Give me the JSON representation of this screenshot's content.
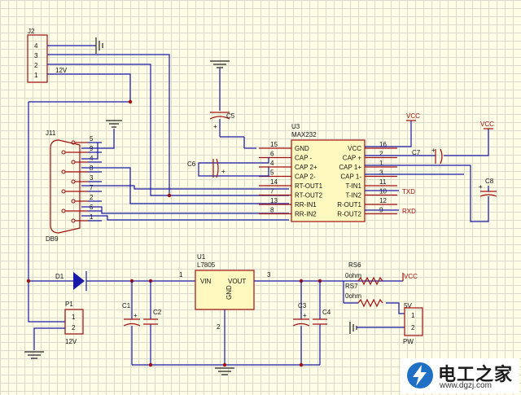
{
  "connector_j2": {
    "ref": "J2",
    "pins": [
      "4",
      "3",
      "2",
      "1"
    ],
    "net": "12V"
  },
  "db9": {
    "ref": "J11",
    "name": "DB9",
    "pins": [
      "5",
      "9",
      "4",
      "8",
      "3",
      "7",
      "2",
      "6",
      "1"
    ]
  },
  "max232": {
    "ref": "U3",
    "part": "MAX232",
    "left_pins": [
      {
        "num": "15",
        "name": "GND"
      },
      {
        "num": "6",
        "name": "CAP -"
      },
      {
        "num": "4",
        "name": "CAP 2+"
      },
      {
        "num": "5",
        "name": "CAP 2-"
      },
      {
        "num": "14",
        "name": "RT-OUT1"
      },
      {
        "num": "7",
        "name": "RT-OUT2"
      },
      {
        "num": "13",
        "name": "RR-IN1"
      },
      {
        "num": "8",
        "name": "RR-IN2"
      }
    ],
    "right_pins": [
      {
        "num": "16",
        "name": "VCC"
      },
      {
        "num": "2",
        "name": "CAP +"
      },
      {
        "num": "1",
        "name": "CAP 1+"
      },
      {
        "num": "3",
        "name": "CAP 1-"
      },
      {
        "num": "11",
        "name": "T-IN1"
      },
      {
        "num": "10",
        "name": "T-IN2"
      },
      {
        "num": "12",
        "name": "R-OUT1"
      },
      {
        "num": "9",
        "name": "R-OUT2"
      }
    ]
  },
  "regulator": {
    "ref": "U1",
    "part": "L7805",
    "vin": "VIN",
    "vout": "VOUT",
    "gnd": "GND",
    "pin_in": "1",
    "pin_out": "3",
    "pin_gnd": "2"
  },
  "caps": {
    "c1": "C1",
    "c2": "C2",
    "c3": "C3",
    "c4": "C4",
    "c5": "C5",
    "c6": "C6",
    "c7": "C7",
    "c8": "C8"
  },
  "diode": "D1",
  "p1": {
    "ref": "P1",
    "pins": [
      "1",
      "2"
    ],
    "net": "12V"
  },
  "pw": {
    "ref": "PW",
    "pins": [
      "1",
      "2"
    ]
  },
  "res": {
    "rs6": "RS6",
    "rs6_val": "0ohm",
    "rs7": "RS7",
    "rs7_val": "0ohm"
  },
  "nets": {
    "vcc": "VCC",
    "v5": "5V",
    "txd": "TXD",
    "rxd": "RXD"
  },
  "plus": "+",
  "logo": {
    "cn": "电工之家",
    "url": "www.dgzj.com"
  },
  "colors": {
    "wire": "#1a1aa8",
    "part": "#a01010",
    "grid": "#d9d9cc",
    "background": "#fffde6"
  }
}
